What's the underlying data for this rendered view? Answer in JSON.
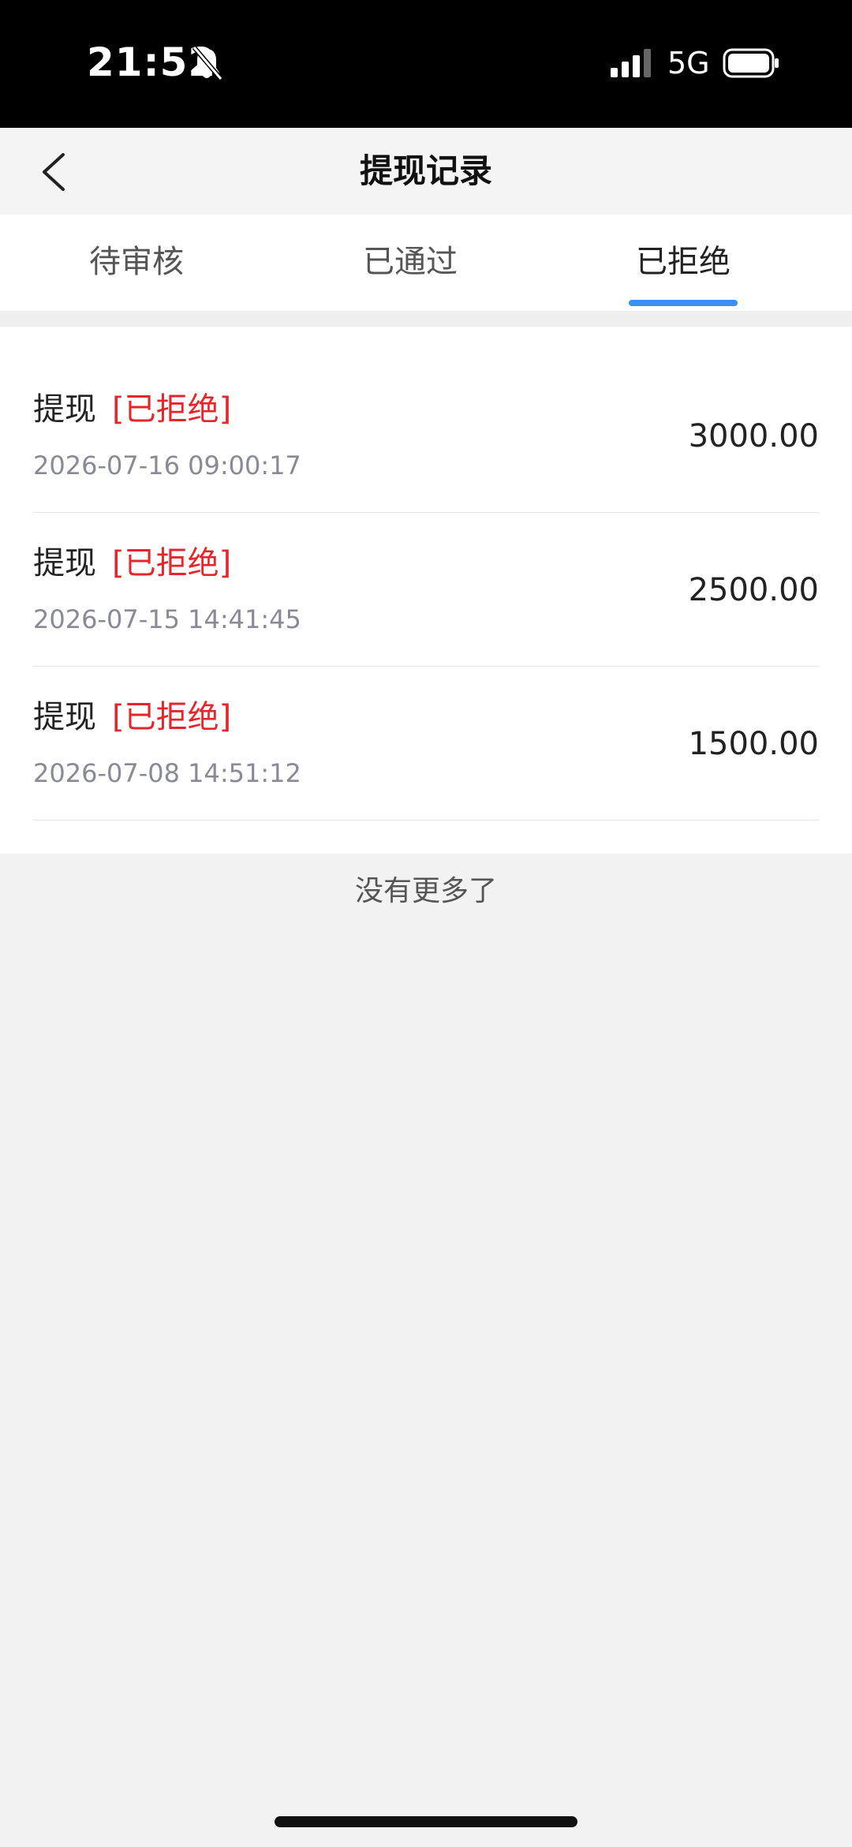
{
  "status_bar": {
    "time": "21:52",
    "network": "5G",
    "icons": [
      "bell-muted-icon",
      "signal-icon",
      "battery-icon"
    ]
  },
  "nav": {
    "title": "提现记录",
    "back_icon": "chevron-left-icon"
  },
  "tabs": [
    {
      "label": "待审核",
      "active": false
    },
    {
      "label": "已通过",
      "active": false
    },
    {
      "label": "已拒绝",
      "active": true
    }
  ],
  "records": [
    {
      "type": "提现",
      "status": "[已拒绝]",
      "time": "2026-07-16 09:00:17",
      "amount": "3000.00"
    },
    {
      "type": "提现",
      "status": "[已拒绝]",
      "time": "2026-07-15 14:41:45",
      "amount": "2500.00"
    },
    {
      "type": "提现",
      "status": "[已拒绝]",
      "time": "2026-07-08 14:51:12",
      "amount": "1500.00"
    }
  ],
  "footer_text": "没有更多了",
  "colors": {
    "accent": "#3a8ff0",
    "rejected": "#e5252a",
    "background": "#f2f2f2"
  }
}
